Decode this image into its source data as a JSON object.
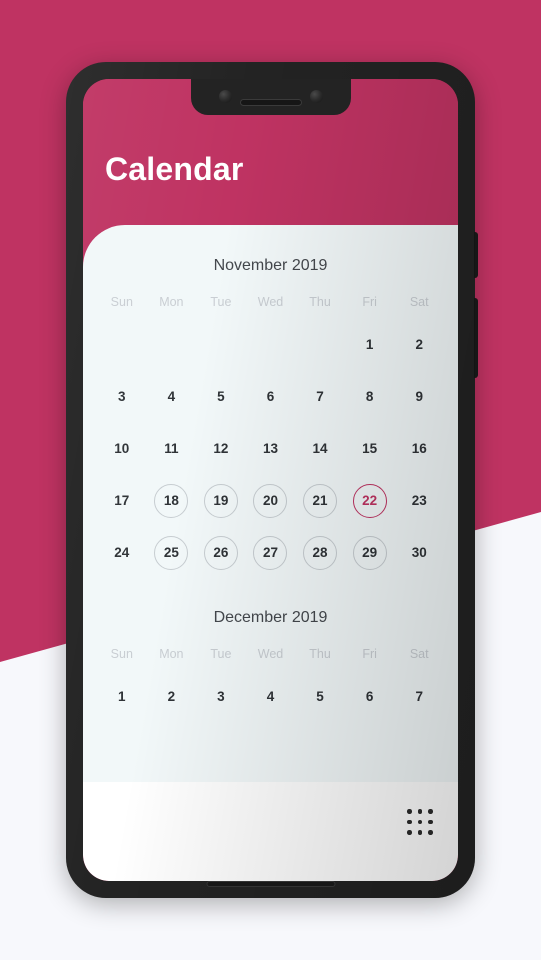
{
  "background": {
    "crimson": "#bf3362",
    "light": "#f7f8fc"
  },
  "device": {
    "body_color": "#232323",
    "notch": {
      "camera_left": "camera-lens",
      "camera_right": "camera-lens",
      "speaker": "earpiece-speaker"
    },
    "buttons": {
      "power": "power-button",
      "volume": "volume-rocker"
    },
    "bottom_speaker": "bottom-speaker-grill"
  },
  "app": {
    "title": "Calendar",
    "accent_color": "#bf3362",
    "card_background": "#f2f8f9"
  },
  "weekdays": [
    "Sun",
    "Mon",
    "Tue",
    "Wed",
    "Thu",
    "Fri",
    "Sat"
  ],
  "months": [
    {
      "title": "November 2019",
      "lead_blank": 5,
      "weeks": [
        [
          {
            "num": "",
            "state": "empty"
          },
          {
            "num": "",
            "state": "empty"
          },
          {
            "num": "",
            "state": "empty"
          },
          {
            "num": "",
            "state": "empty"
          },
          {
            "num": "",
            "state": "empty"
          },
          {
            "num": "1",
            "state": "plain"
          },
          {
            "num": "2",
            "state": "plain"
          }
        ],
        [
          {
            "num": "3",
            "state": "plain"
          },
          {
            "num": "4",
            "state": "plain"
          },
          {
            "num": "5",
            "state": "plain"
          },
          {
            "num": "6",
            "state": "plain"
          },
          {
            "num": "7",
            "state": "plain"
          },
          {
            "num": "8",
            "state": "plain"
          },
          {
            "num": "9",
            "state": "plain"
          }
        ],
        [
          {
            "num": "10",
            "state": "plain"
          },
          {
            "num": "11",
            "state": "plain"
          },
          {
            "num": "12",
            "state": "plain"
          },
          {
            "num": "13",
            "state": "plain"
          },
          {
            "num": "14",
            "state": "plain"
          },
          {
            "num": "15",
            "state": "plain"
          },
          {
            "num": "16",
            "state": "plain"
          }
        ],
        [
          {
            "num": "17",
            "state": "plain"
          },
          {
            "num": "18",
            "state": "circled"
          },
          {
            "num": "19",
            "state": "circled"
          },
          {
            "num": "20",
            "state": "circled"
          },
          {
            "num": "21",
            "state": "circled"
          },
          {
            "num": "22",
            "state": "today"
          },
          {
            "num": "23",
            "state": "plain"
          }
        ],
        [
          {
            "num": "24",
            "state": "plain"
          },
          {
            "num": "25",
            "state": "circled"
          },
          {
            "num": "26",
            "state": "circled"
          },
          {
            "num": "27",
            "state": "circled"
          },
          {
            "num": "28",
            "state": "circled"
          },
          {
            "num": "29",
            "state": "circled"
          },
          {
            "num": "30",
            "state": "plain"
          }
        ]
      ]
    },
    {
      "title": "December 2019",
      "lead_blank": 0,
      "weeks": [
        [
          {
            "num": "1",
            "state": "plain"
          },
          {
            "num": "2",
            "state": "plain"
          },
          {
            "num": "3",
            "state": "plain"
          },
          {
            "num": "4",
            "state": "plain"
          },
          {
            "num": "5",
            "state": "plain"
          },
          {
            "num": "6",
            "state": "plain"
          },
          {
            "num": "7",
            "state": "plain"
          }
        ]
      ]
    }
  ],
  "bottom_bar": {
    "apps_icon": "apps-grid-icon"
  }
}
